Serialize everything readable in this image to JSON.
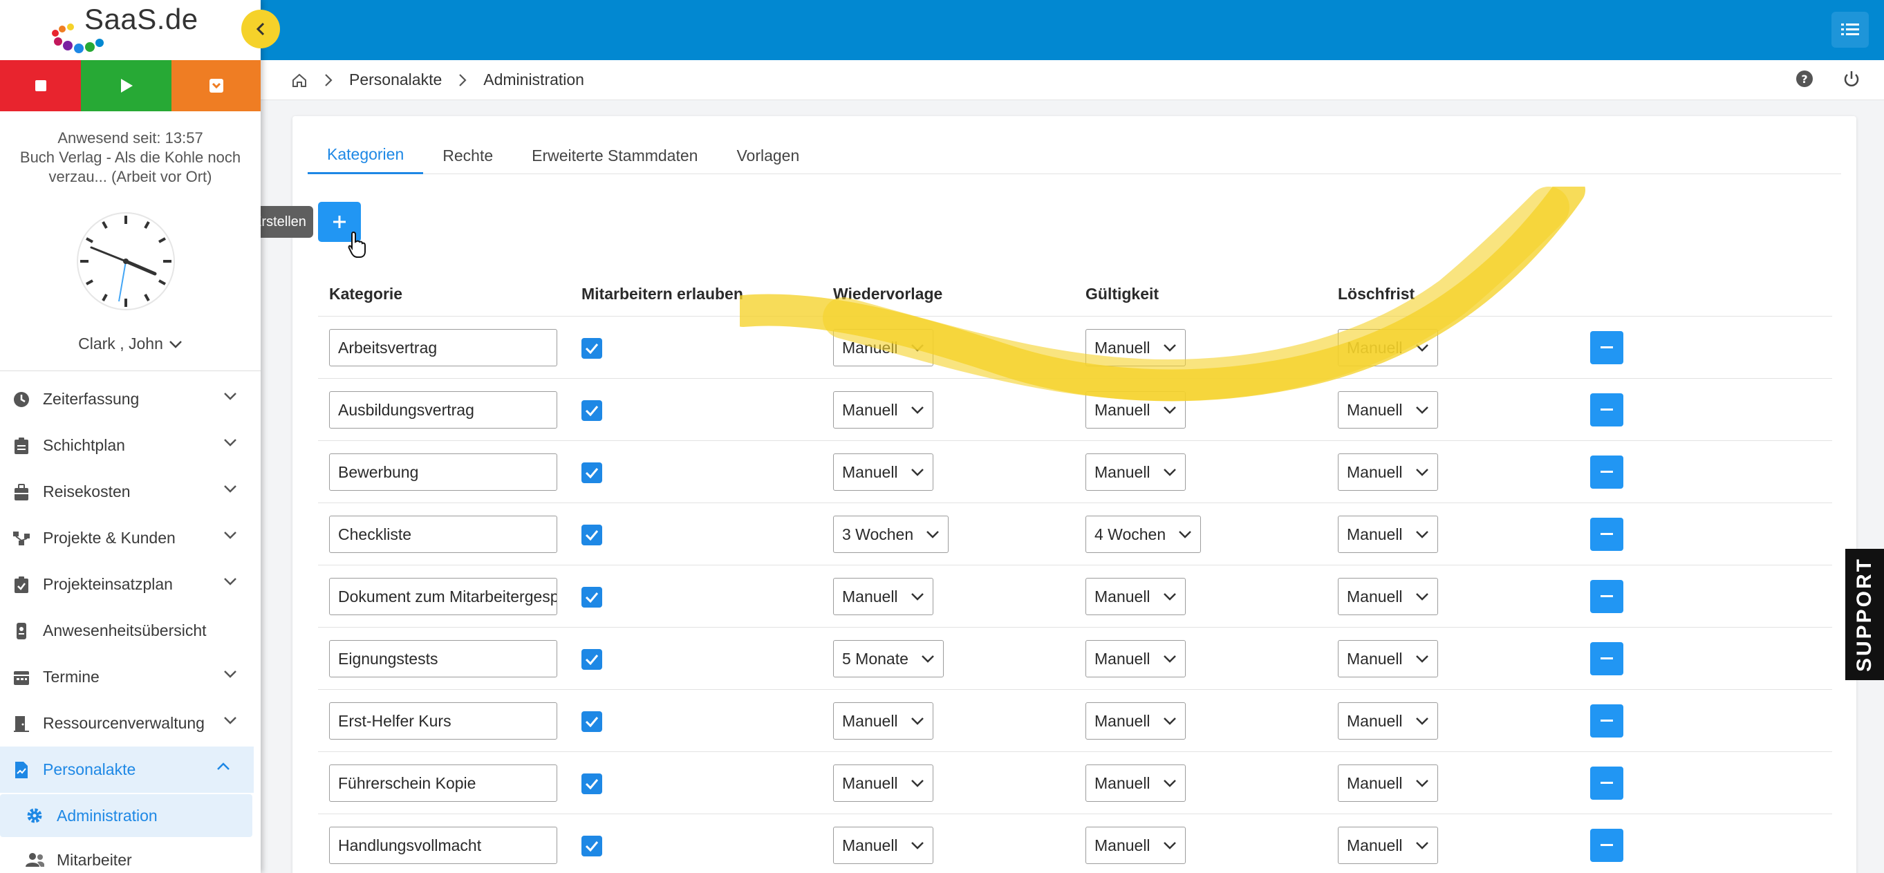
{
  "logo": {
    "text": "SaaS.de"
  },
  "timer": {
    "stop_icon": "stop-icon",
    "play_icon": "play-icon",
    "break_icon": "pause-icon"
  },
  "presence": {
    "line1": "Anwesend seit: 13:57",
    "line2": "Buch Verlag - Als die Kohle noch",
    "line3": "verzau... (Arbeit vor Ort)"
  },
  "user": {
    "name": "Clark , John"
  },
  "sidebar": {
    "items": [
      {
        "label": "Zeiterfassung",
        "icon": "clock-icon"
      },
      {
        "label": "Schichtplan",
        "icon": "clipboard-icon"
      },
      {
        "label": "Reisekosten",
        "icon": "briefcase-icon"
      },
      {
        "label": "Projekte & Kunden",
        "icon": "sitemap-icon"
      },
      {
        "label": "Projekteinsatzplan",
        "icon": "clipboard-check-icon"
      },
      {
        "label": "Anwesenheitsübersicht",
        "icon": "badge-icon"
      },
      {
        "label": "Termine",
        "icon": "calendar-icon"
      },
      {
        "label": "Ressourcenverwaltung",
        "icon": "door-icon"
      },
      {
        "label": "Personalakte",
        "icon": "file-icon"
      }
    ],
    "sub": [
      {
        "label": "Administration",
        "icon": "gear-icon"
      },
      {
        "label": "Mitarbeiter",
        "icon": "users-icon"
      }
    ]
  },
  "breadcrumb": {
    "items": [
      "Personalakte",
      "Administration"
    ]
  },
  "tabs": [
    "Kategorien",
    "Rechte",
    "Erweiterte Stammdaten",
    "Vorlagen"
  ],
  "create": {
    "tooltip": "Erstellen",
    "label": "+"
  },
  "table": {
    "headers": [
      "Kategorie",
      "Mitarbeitern erlauben",
      "Wiedervorlage",
      "Gültigkeit",
      "Löschfrist"
    ],
    "rows": [
      {
        "name": "Arbeitsvertrag",
        "allow": true,
        "wiedervorlage": "Manuell",
        "gueltigkeit": "Manuell",
        "loeschfrist": "Manuell"
      },
      {
        "name": "Ausbildungsvertrag",
        "allow": true,
        "wiedervorlage": "Manuell",
        "gueltigkeit": "Manuell",
        "loeschfrist": "Manuell"
      },
      {
        "name": "Bewerbung",
        "allow": true,
        "wiedervorlage": "Manuell",
        "gueltigkeit": "Manuell",
        "loeschfrist": "Manuell"
      },
      {
        "name": "Checkliste",
        "allow": true,
        "wiedervorlage": "3 Wochen",
        "gueltigkeit": "4 Wochen",
        "loeschfrist": "Manuell"
      },
      {
        "name": "Dokument zum Mitarbeitergespräch",
        "allow": true,
        "wiedervorlage": "Manuell",
        "gueltigkeit": "Manuell",
        "loeschfrist": "Manuell"
      },
      {
        "name": "Eignungstests",
        "allow": true,
        "wiedervorlage": "5 Monate",
        "gueltigkeit": "Manuell",
        "loeschfrist": "Manuell"
      },
      {
        "name": "Erst-Helfer Kurs",
        "allow": true,
        "wiedervorlage": "Manuell",
        "gueltigkeit": "Manuell",
        "loeschfrist": "Manuell"
      },
      {
        "name": "Führerschein Kopie",
        "allow": true,
        "wiedervorlage": "Manuell",
        "gueltigkeit": "Manuell",
        "loeschfrist": "Manuell"
      },
      {
        "name": "Handlungsvollmacht",
        "allow": true,
        "wiedervorlage": "Manuell",
        "gueltigkeit": "Manuell",
        "loeschfrist": "Manuell"
      }
    ]
  },
  "support": {
    "label": "SUPPORT"
  },
  "colors": {
    "primary": "#0288d1",
    "accent": "#2196f3",
    "highlight": "#f5d22a",
    "stop": "#e8242e",
    "play": "#27a935",
    "break": "#ef7d23"
  }
}
